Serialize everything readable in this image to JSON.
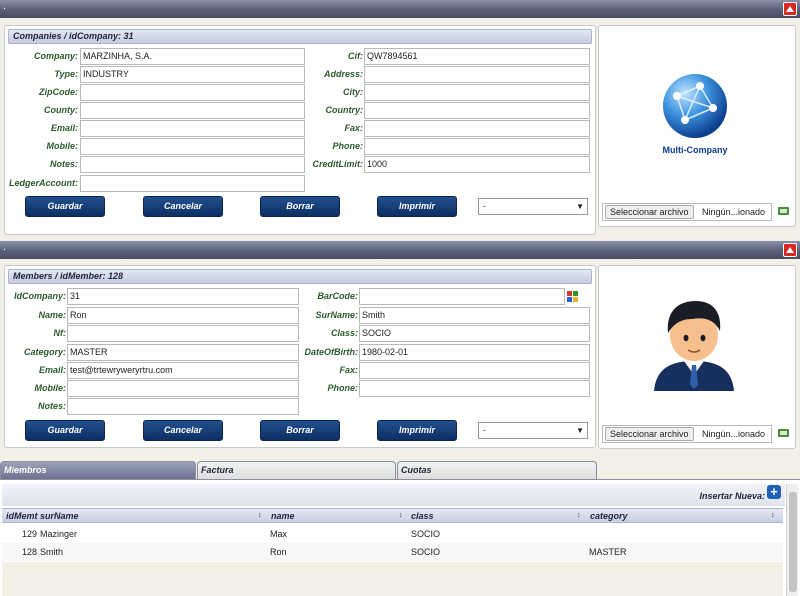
{
  "window1": {
    "title_dot": "."
  },
  "company": {
    "header": "Companies / idCompany: 31",
    "labels": {
      "company": "Company:",
      "type": "Type:",
      "zipcode": "ZipCode:",
      "county": "County:",
      "email": "Email:",
      "mobile": "Mobile:",
      "notes": "Notes:",
      "ledger": "LedgerAccount:",
      "cif": "Cif:",
      "address": "Address:",
      "city": "City:",
      "country": "Country:",
      "fax": "Fax:",
      "phone": "Phone:",
      "creditlimit": "CreditLimit:"
    },
    "values": {
      "company": "MARZINHA, S.A.",
      "type": "INDUSTRY",
      "zipcode": "",
      "county": "",
      "email": "",
      "mobile": "",
      "notes": "",
      "ledger": "",
      "cif": "QW7894561",
      "address": "",
      "city": "",
      "country": "",
      "fax": "",
      "phone": "",
      "creditlimit": "1000"
    },
    "buttons": {
      "save": "Guardar",
      "cancel": "Cancelar",
      "delete": "Borrar",
      "print": "Imprimir"
    },
    "select_value": "-",
    "logo_text": "Multi-Company",
    "file_button": "Seleccionar archivo",
    "file_text": "Ningún...ionado"
  },
  "window2": {
    "title_dot": "."
  },
  "member": {
    "header": "Members / idMember: 128",
    "labels": {
      "idcompany": "IdCompany:",
      "name": "Name:",
      "nf": "Nf:",
      "category": "Category:",
      "email": "Email:",
      "mobile": "Mobile:",
      "notes": "Notes:",
      "barcode": "BarCode:",
      "surname": "SurName:",
      "class": "Class:",
      "dob": "DateOfBirth:",
      "fax": "Fax:",
      "phone": "Phone:"
    },
    "values": {
      "idcompany": "31",
      "name": "Ron",
      "nf": "",
      "category": "MASTER",
      "email": "test@trtewryweryrtru.com",
      "mobile": "",
      "notes": "",
      "barcode": "",
      "surname": "Smith",
      "class": "SOCIO",
      "dob": "1980-02-01",
      "fax": "",
      "phone": ""
    },
    "buttons": {
      "save": "Guardar",
      "cancel": "Cancelar",
      "delete": "Borrar",
      "print": "Imprimir"
    },
    "select_value": "-",
    "file_button": "Seleccionar archivo",
    "file_text": "Ningún...ionado"
  },
  "tabs": [
    {
      "label": "Miembros"
    },
    {
      "label": "Factura"
    },
    {
      "label": "Cuotas"
    }
  ],
  "grid": {
    "insert_label": "Insertar Nueva:",
    "columns": [
      "idMemt",
      "surName",
      "name",
      "class",
      "category"
    ],
    "rows": [
      {
        "id": "129",
        "surname": "Mazinger",
        "name": "Max",
        "class": "SOCIO",
        "category": ""
      },
      {
        "id": "128",
        "surname": "Smith",
        "name": "Ron",
        "class": "SOCIO",
        "category": "MASTER"
      }
    ]
  },
  "colors": {
    "label_green": "#2c5b2c",
    "button_blue": "#0d2f63",
    "close_red": "#d8281f"
  }
}
